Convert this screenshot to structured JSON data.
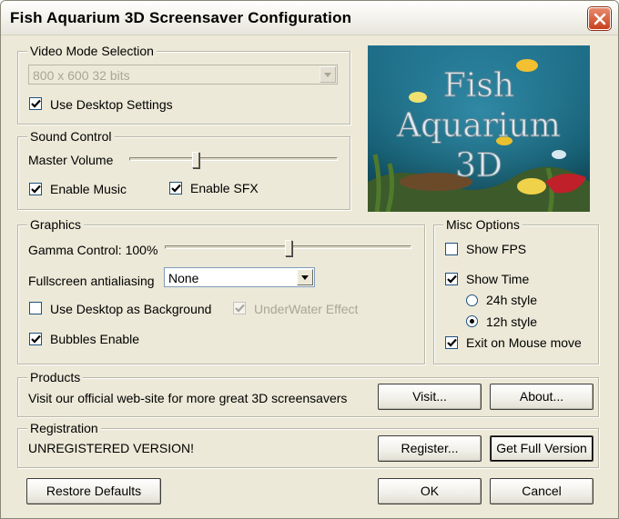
{
  "window": {
    "title": "Fish Aquarium 3D Screensaver Configuration"
  },
  "video": {
    "legend": "Video Mode Selection",
    "mode_value": "800 x 600 32 bits",
    "use_desktop_label": "Use Desktop Settings",
    "use_desktop_checked": true
  },
  "sound": {
    "legend": "Sound Control",
    "master_volume_label": "Master Volume",
    "master_volume_level": 0.32,
    "enable_music_label": "Enable Music",
    "enable_music_checked": true,
    "enable_sfx_label": "Enable SFX",
    "enable_sfx_checked": true
  },
  "logo": {
    "line1": "Fish",
    "line2": "Aquarium",
    "line3": "3D"
  },
  "graphics": {
    "legend": "Graphics",
    "gamma_label": "Gamma Control: 100%",
    "gamma_level": 0.5,
    "fsaa_label": "Fullscreen antialiasing",
    "fsaa_value": "None",
    "desktop_bg_label": "Use Desktop as Background",
    "desktop_bg_checked": false,
    "underwater_label": "UnderWater Effect",
    "underwater_checked": true,
    "bubbles_label": "Bubbles Enable",
    "bubbles_checked": true
  },
  "misc": {
    "legend": "Misc Options",
    "show_fps_label": "Show FPS",
    "show_fps_checked": false,
    "show_time_label": "Show Time",
    "show_time_checked": true,
    "style_24h_label": "24h style",
    "style_12h_label": "12h style",
    "selected_style": "12h",
    "exit_mouse_label": "Exit on Mouse move",
    "exit_mouse_checked": true
  },
  "products": {
    "legend": "Products",
    "text": "Visit our official web-site for more great 3D screensavers",
    "visit_label": "Visit...",
    "about_label": "About..."
  },
  "registration": {
    "legend": "Registration",
    "status": "UNREGISTERED VERSION!",
    "register_label": "Register...",
    "full_version_label": "Get Full Version"
  },
  "footer": {
    "restore_label": "Restore Defaults",
    "ok_label": "OK",
    "cancel_label": "Cancel"
  }
}
